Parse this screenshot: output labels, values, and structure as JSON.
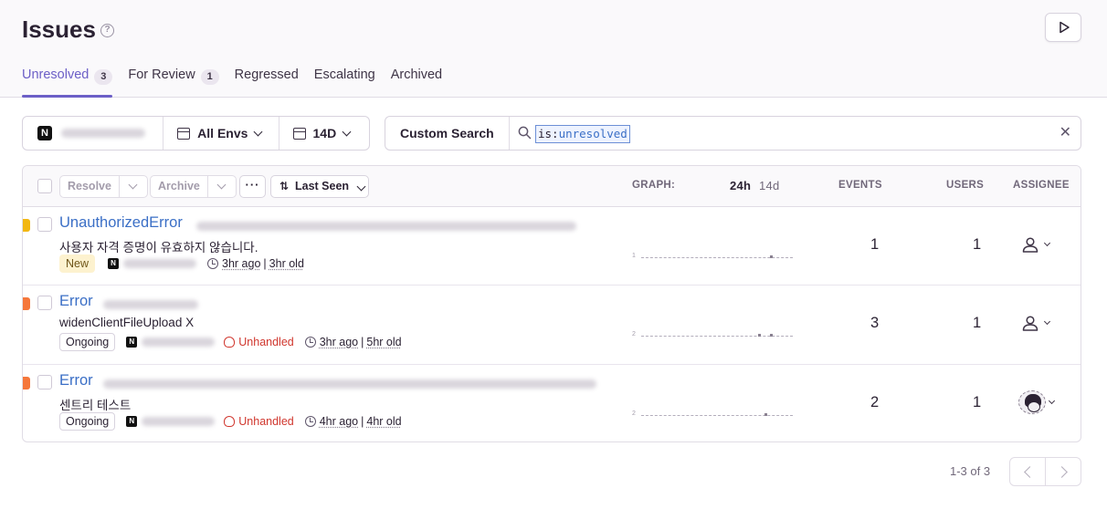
{
  "page": {
    "title": "Issues",
    "help_glyph": "?"
  },
  "tabs": [
    {
      "label": "Unresolved",
      "count": "3",
      "active": true
    },
    {
      "label": "For Review",
      "count": "1",
      "active": false
    },
    {
      "label": "Regressed",
      "count": null,
      "active": false
    },
    {
      "label": "Escalating",
      "count": null,
      "active": false
    },
    {
      "label": "Archived",
      "count": null,
      "active": false
    }
  ],
  "filters": {
    "project_icon": "N",
    "environment": "All Envs",
    "date_range": "14D"
  },
  "search": {
    "custom_search_label": "Custom Search",
    "query_key": "is:",
    "query_value": "unresolved"
  },
  "table": {
    "toolbar": {
      "resolve_label": "Resolve",
      "archive_label": "Archive",
      "more_label": "···",
      "sort_label": "Last Seen"
    },
    "columns": {
      "graph": "GRAPH:",
      "graph_24h": "24h",
      "graph_14d": "14d",
      "events": "EVENTS",
      "users": "USERS",
      "assignee": "ASSIGNEE"
    },
    "rows": [
      {
        "type": "UnauthorizedError",
        "subtitle": "사용자 자격 증명이 유효하지 않습니다.",
        "status": "New",
        "unhandled": null,
        "last_seen": "3hr ago",
        "age": "3hr old",
        "graph_label": "1",
        "events": "1",
        "users": "1",
        "assignee": "unassigned",
        "level_color": "#f2b712"
      },
      {
        "type": "Error",
        "subtitle": "widenClientFileUpload X",
        "status": "Ongoing",
        "unhandled": "Unhandled",
        "last_seen": "3hr ago",
        "age": "5hr old",
        "graph_label": "2",
        "events": "3",
        "users": "1",
        "assignee": "unassigned",
        "level_color": "#f5773b"
      },
      {
        "type": "Error",
        "subtitle": "센트리 테스트",
        "status": "Ongoing",
        "unhandled": "Unhandled",
        "last_seen": "4hr ago",
        "age": "4hr old",
        "graph_label": "2",
        "events": "2",
        "users": "1",
        "assignee": "avatar",
        "level_color": "#f5773b"
      }
    ]
  },
  "pagination": {
    "summary": "1-3 of 3"
  },
  "colors": {
    "accent": "#6c5fc7",
    "link": "#3b6fc6",
    "error": "#d0362d"
  }
}
